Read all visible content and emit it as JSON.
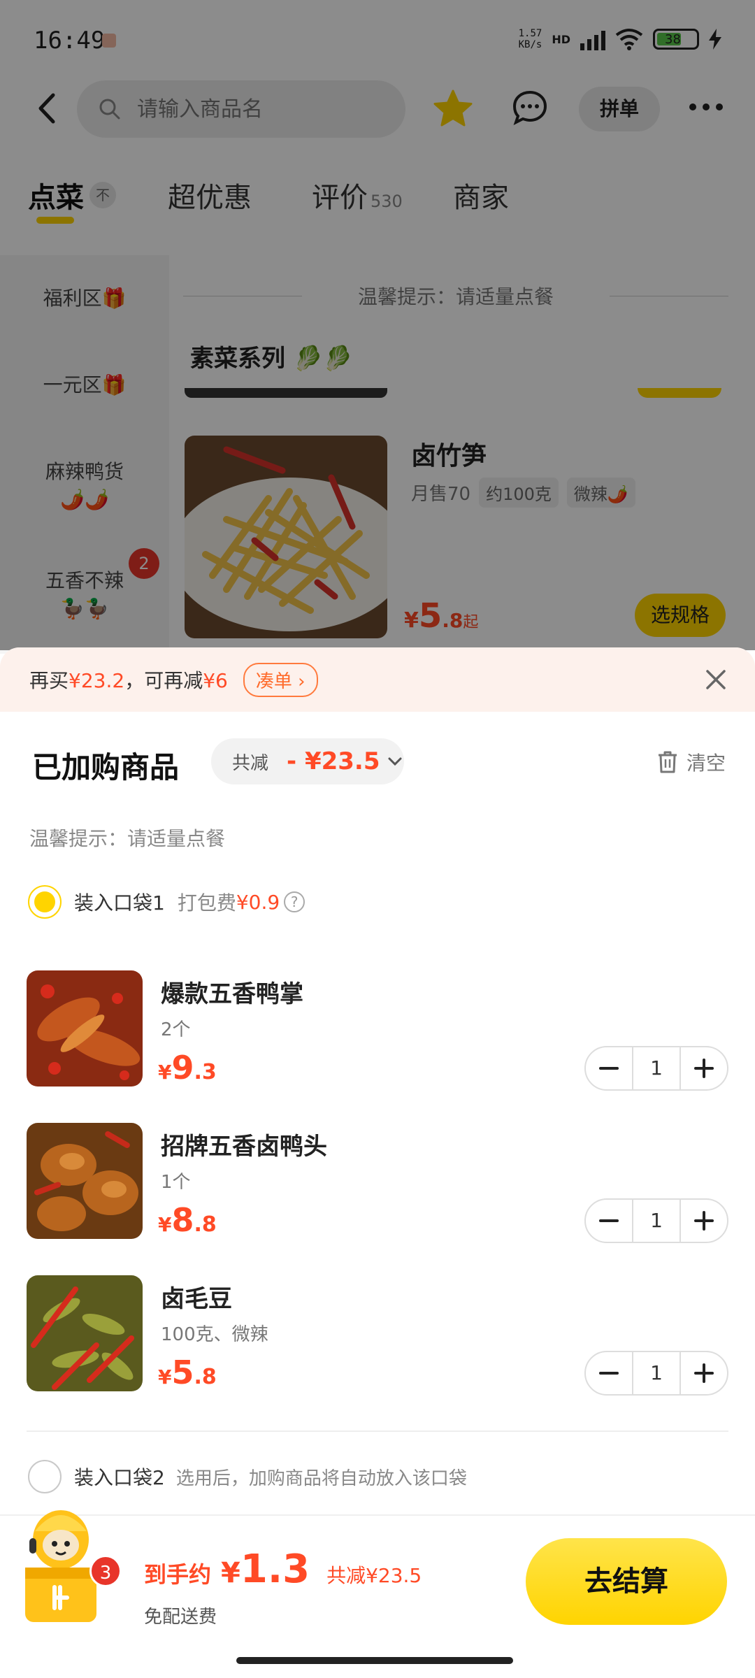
{
  "status": {
    "time": "16:49",
    "net_speed_top": "1.57",
    "net_speed_bottom": "KB/s",
    "network": "HD",
    "battery": "38"
  },
  "search": {
    "placeholder": "请输入商品名"
  },
  "header": {
    "pin_label": "拼单"
  },
  "tabs": [
    {
      "label": "点菜"
    },
    {
      "label": "超优惠"
    },
    {
      "label": "评价",
      "count": "530"
    },
    {
      "label": "商家"
    }
  ],
  "tab_collapse_label": "不",
  "categories": [
    {
      "label": "福利区🎁"
    },
    {
      "label": "一元区🎁"
    },
    {
      "label": "麻辣鸭货",
      "emoji": "🌶️🌶️"
    },
    {
      "label": "五香不辣",
      "emoji": "🦆🦆",
      "badge": "2"
    }
  ],
  "menu": {
    "tip": "温馨提示：请适量点餐",
    "series_title": "素菜系列 🥬🥬",
    "dish": {
      "name": "卤竹笋",
      "monthly_sales": "月售70",
      "tags": [
        "约100克",
        "微辣🌶️"
      ],
      "price_currency": "¥",
      "price_int": "5",
      "price_dec": ".8",
      "price_suffix": "起",
      "spec_button": "选规格"
    }
  },
  "promo": {
    "prefix": "再买",
    "amount1": "¥23.2",
    "middle": "，可再减",
    "amount2": "¥6",
    "button": "凑单"
  },
  "sheet": {
    "title": "已加购商品",
    "discount_label": "共减",
    "discount_value": "- ¥23.5",
    "clear_label": "清空",
    "tip": "温馨提示：请适量点餐",
    "bag1": {
      "label": "装入口袋1",
      "fee_label": "打包费",
      "fee_value": "¥0.9"
    },
    "bag2": {
      "label": "装入口袋2",
      "hint": "选用后，加购商品将自动放入该口袋"
    },
    "items": [
      {
        "name": "爆款五香鸭掌",
        "spec": "2个",
        "currency": "¥",
        "price_int": "9",
        "price_dec": ".3",
        "qty": "1"
      },
      {
        "name": "招牌五香卤鸭头",
        "spec": "1个",
        "currency": "¥",
        "price_int": "8",
        "price_dec": ".8",
        "qty": "1"
      },
      {
        "name": "卤毛豆",
        "spec": "100克、微辣",
        "currency": "¥",
        "price_int": "5",
        "price_dec": ".8",
        "qty": "1"
      }
    ]
  },
  "checkout": {
    "cart_count": "3",
    "price_label": "到手约",
    "currency": "¥",
    "price": "1.3",
    "saved": "共减¥23.5",
    "delivery": "免配送费",
    "button": "去结算"
  },
  "colors": {
    "accent": "#ffd400",
    "price_red": "#ff4a26",
    "badge_red": "#e8352a"
  }
}
